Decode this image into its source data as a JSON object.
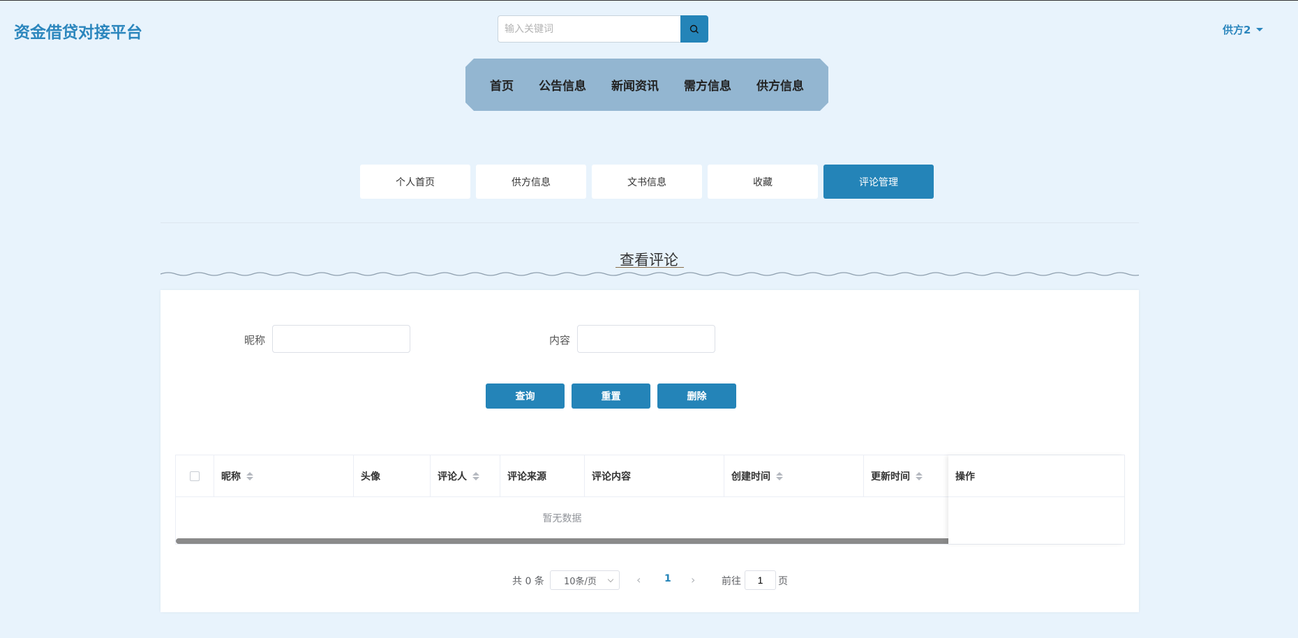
{
  "header": {
    "brand": "资金借贷对接平台",
    "search_placeholder": "输入关键词",
    "user_name": "供方2"
  },
  "main_nav": {
    "items": [
      {
        "label": "首页"
      },
      {
        "label": "公告信息"
      },
      {
        "label": "新闻资讯"
      },
      {
        "label": "需方信息"
      },
      {
        "label": "供方信息"
      }
    ]
  },
  "sub_tabs": {
    "items": [
      {
        "label": "个人首页"
      },
      {
        "label": "供方信息"
      },
      {
        "label": "文书信息"
      },
      {
        "label": "收藏"
      },
      {
        "label": "评论管理"
      }
    ],
    "active": "评论管理"
  },
  "section": {
    "title": "查看评论"
  },
  "filters": {
    "nickname_label": "昵称",
    "nickname_value": "",
    "content_label": "内容",
    "content_value": ""
  },
  "actions": {
    "query": "查询",
    "reset": "重置",
    "delete": "删除"
  },
  "table": {
    "columns": [
      "昵称",
      "头像",
      "评论人",
      "评论来源",
      "评论内容",
      "创建时间",
      "更新时间",
      "操作"
    ],
    "empty_text": "暂无数据"
  },
  "pagination": {
    "total_text": "共 0 条",
    "page_size": "10条/页",
    "current_page": "1",
    "goto_label": "前往",
    "goto_value": "1",
    "page_unit": "页"
  },
  "colors": {
    "primary": "#2484b8",
    "background": "#e8f3fc",
    "nav_bg": "#93b6d1"
  }
}
